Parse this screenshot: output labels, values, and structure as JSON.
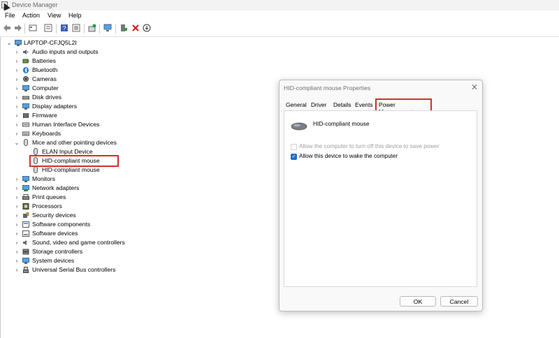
{
  "window": {
    "title": "Device Manager"
  },
  "menu": [
    "File",
    "Action",
    "View",
    "Help"
  ],
  "toolbar": [
    "back-arrow-icon",
    "forward-arrow-icon",
    "properties-icon",
    "show-hide-icon",
    "help-icon",
    "view-icon",
    "update-driver-icon",
    "scan-hardware-icon",
    "add-driver-icon",
    "uninstall-icon",
    "disable-icon"
  ],
  "tree": {
    "root": "LAPTOP-CFJQ5L2I",
    "items": [
      "Audio inputs and outputs",
      "Batteries",
      "Bluetooth",
      "Cameras",
      "Computer",
      "Disk drives",
      "Display adapters",
      "Firmware",
      "Human Interface Devices",
      "Keyboards",
      "Mice and other pointing devices",
      "ELAN Input Device",
      "HID-compliant mouse",
      "HID-compliant mouse",
      "Monitors",
      "Network adapters",
      "Print queues",
      "Processors",
      "Security devices",
      "Software components",
      "Software devices",
      "Sound, video and game controllers",
      "Storage controllers",
      "System devices",
      "Universal Serial Bus controllers"
    ]
  },
  "dialog": {
    "title": "HID-compliant mouse Properties",
    "tabs": [
      "General",
      "Driver",
      "Details",
      "Events",
      "Power Management"
    ],
    "device_name": "HID-compliant mouse",
    "options": [
      {
        "label": "Allow the computer to turn off this device to save power",
        "checked": false,
        "enabled": false
      },
      {
        "label": "Allow this device to wake the computer",
        "checked": true,
        "enabled": true
      }
    ],
    "ok_label": "OK",
    "cancel_label": "Cancel"
  },
  "colors": {
    "highlight": "#d32f2f",
    "checkbox": "#1f6fc8"
  }
}
